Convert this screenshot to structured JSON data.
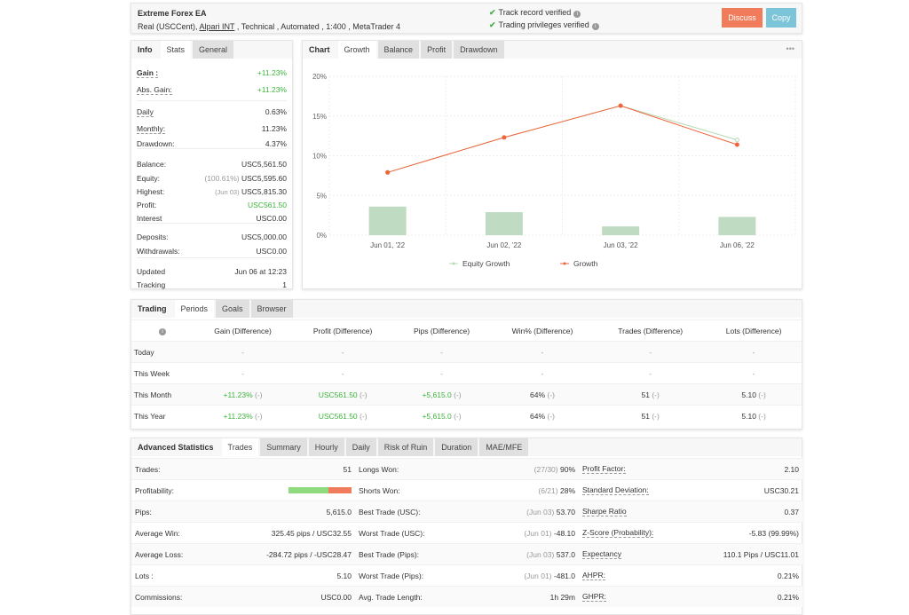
{
  "header": {
    "title": "Extreme Forex EA",
    "sub_prefix": "Real (USCCent), ",
    "broker": "Alpari INT",
    "sub_suffix": " , Technical , Automated , 1:400 , MetaTrader 4",
    "verified": [
      "Track record verified",
      "Trading privileges verified"
    ],
    "discuss": "Discuss",
    "copy": "Copy"
  },
  "colors": {
    "discuss": "#f07c5b",
    "copy": "#7cc4d8",
    "green": "#3cb33c",
    "growth": "#f0643c",
    "equity": "#b5d8b5",
    "bars": "#bfdcc2"
  },
  "info": {
    "tabs": [
      "Info",
      "Stats",
      "General"
    ],
    "rows": [
      {
        "label": "Gain :",
        "value": "+11.23%",
        "green": true,
        "ul": true
      },
      {
        "label": "Abs. Gain:",
        "value": "+11.23%",
        "green": true,
        "ul": true
      },
      {
        "label": "Daily",
        "value": "0.63%",
        "ul": true
      },
      {
        "label": "Monthly:",
        "value": "11.23%",
        "ul": true
      },
      {
        "label": "Drawdown:",
        "value": "4.37%"
      },
      {
        "label": "Balance:",
        "value": "USC5,561.50"
      },
      {
        "label": "Equity:",
        "pre": "(100.61%)",
        "value": "USC5,595.60"
      },
      {
        "label": "Highest:",
        "pre": "(Jun 03)",
        "value": "USC5,815.30"
      },
      {
        "label": "Profit:",
        "value": "USC561.50",
        "green": true
      },
      {
        "label": "Interest",
        "value": "USC0.00"
      },
      {
        "label": "Deposits:",
        "value": "USC5,000.00"
      },
      {
        "label": "Withdrawals:",
        "value": "USC0.00"
      },
      {
        "label": "Updated",
        "value": "Jun 06 at 12:23"
      },
      {
        "label": "Tracking",
        "value": "1"
      }
    ]
  },
  "chart": {
    "tabs": [
      "Chart",
      "Growth",
      "Balance",
      "Profit",
      "Drawdown"
    ],
    "more": "•••"
  },
  "chart_data": {
    "type": "line",
    "categories": [
      "Jun 01, '22",
      "Jun 02, '22",
      "Jun 03, '22",
      "Jun 06, '22"
    ],
    "yticks": [
      "0%",
      "5%",
      "10%",
      "15%",
      "20%"
    ],
    "ylim": [
      0,
      20
    ],
    "grid": true,
    "legend": "bottom",
    "series": [
      {
        "name": "Equity Growth",
        "type": "line",
        "values": [
          7.9,
          12.3,
          16.3,
          12.0
        ]
      },
      {
        "name": "Growth",
        "type": "line",
        "values": [
          7.9,
          12.3,
          16.3,
          11.4
        ]
      },
      {
        "type": "bar",
        "values": [
          3.6,
          2.9,
          1.1,
          2.3
        ]
      }
    ]
  },
  "trading": {
    "tabs": [
      "Trading",
      "Periods",
      "Goals",
      "Browser"
    ],
    "info_icon": "i",
    "headers": [
      "Gain (Difference)",
      "Profit (Difference)",
      "Pips (Difference)",
      "Win% (Difference)",
      "Trades (Difference)",
      "Lots (Difference)"
    ],
    "rows": [
      {
        "label": "Today",
        "cells": [
          "-",
          "-",
          "-",
          "-",
          "-",
          "-"
        ]
      },
      {
        "label": "This Week",
        "cells": [
          "-",
          "-",
          "-",
          "-",
          "-",
          "-"
        ]
      },
      {
        "label": "This Month",
        "cells": [
          "+11.23%",
          "USC561.50",
          "+5,615.0",
          "64%",
          "51",
          "5.10"
        ],
        "diff": "(-)"
      },
      {
        "label": "This Year",
        "cells": [
          "+11.23%",
          "USC561.50",
          "+5,615.0",
          "64%",
          "51",
          "5.10"
        ],
        "diff": "(-)"
      }
    ]
  },
  "advanced": {
    "tabs": [
      "Advanced Statistics",
      "Trades",
      "Summary",
      "Hourly",
      "Daily",
      "Risk of Ruin",
      "Duration",
      "MAE/MFE"
    ],
    "profitability_pct": 64,
    "rows": [
      [
        {
          "label": "Trades:",
          "value": "51"
        },
        {
          "label": "Longs Won:",
          "pre": "(27/30)",
          "value": "90%"
        },
        {
          "label": "Profit Factor:",
          "value": "2.10",
          "ul": true
        }
      ],
      [
        {
          "label": "Profitability:",
          "bar": true
        },
        {
          "label": "Shorts Won:",
          "pre": "(6/21)",
          "value": "28%"
        },
        {
          "label": "Standard Deviation:",
          "value": "USC30.21",
          "ul": true
        }
      ],
      [
        {
          "label": "Pips:",
          "value": "5,615.0"
        },
        {
          "label": "Best Trade (USC):",
          "pre": "(Jun 03)",
          "value": "53.70"
        },
        {
          "label": "Sharpe Ratio",
          "value": "0.37",
          "ul": true
        }
      ],
      [
        {
          "label": "Average Win:",
          "value": "325.45 pips / USC32.55"
        },
        {
          "label": "Worst Trade (USC):",
          "pre": "(Jun 01)",
          "value": "-48.10"
        },
        {
          "label": "Z-Score (Probability):",
          "value": "-5.83 (99.99%)",
          "ul": true
        }
      ],
      [
        {
          "label": "Average Loss:",
          "value": "-284.72 pips / -USC28.47"
        },
        {
          "label": "Best Trade (Pips):",
          "pre": "(Jun 03)",
          "value": "537.0"
        },
        {
          "label": "Expectancy",
          "value": "110.1 Pips / USC11.01",
          "ul": true
        }
      ],
      [
        {
          "label": "Lots :",
          "value": "5.10"
        },
        {
          "label": "Worst Trade (Pips):",
          "pre": "(Jun 01)",
          "value": "-481.0"
        },
        {
          "label": "AHPR:",
          "value": "0.21%",
          "ul": true
        }
      ],
      [
        {
          "label": "Commissions:",
          "value": "USC0.00"
        },
        {
          "label": "Avg. Trade Length:",
          "value": "1h 29m"
        },
        {
          "label": "GHPR:",
          "value": "0.21%",
          "ul": true
        }
      ]
    ]
  }
}
